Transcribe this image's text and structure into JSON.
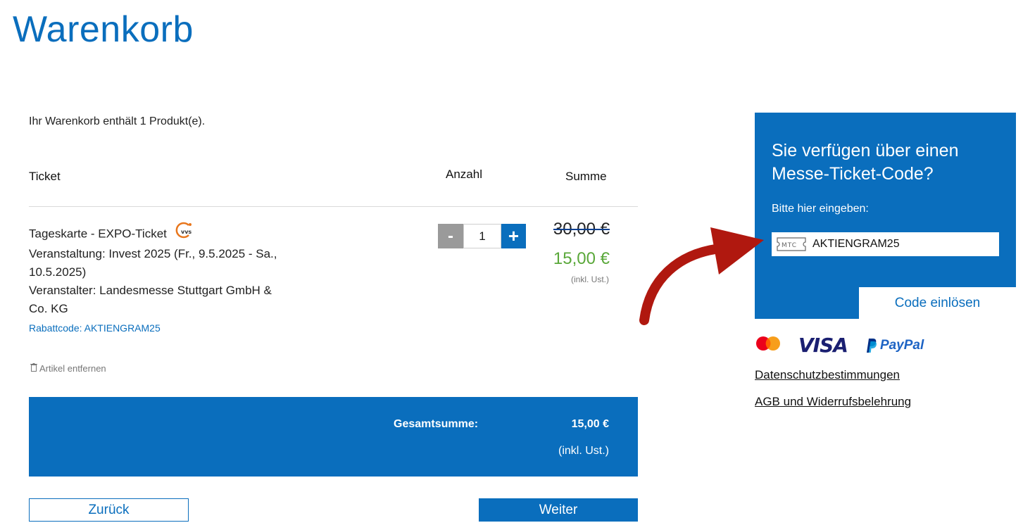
{
  "page": {
    "title": "Warenkorb",
    "cart_count_text": "Ihr Warenkorb enthält 1 Produkt(e)."
  },
  "table": {
    "col_ticket": "Ticket",
    "col_qty": "Anzahl",
    "col_sum": "Summe"
  },
  "item": {
    "name": "Tageskarte - EXPO-Ticket",
    "badge_text": "vvs",
    "event_line": "Veranstaltung: Invest 2025 (Fr., 9.5.2025 - Sa., 10.5.2025)",
    "organizer_line": "Veranstalter: Landesmesse Stuttgart GmbH & Co. KG",
    "discount_line": "Rabattcode: AKTIENGRAM25",
    "quantity": "1",
    "minus_label": "-",
    "plus_label": "+",
    "price_old": "30,00 €",
    "price_new": "15,00 €",
    "price_tax": "(inkl. Ust.)",
    "remove_label": "Artikel entfernen"
  },
  "total": {
    "label": "Gesamtsumme:",
    "value": "15,00 €",
    "tax": "(inkl. Ust.)"
  },
  "buttons": {
    "back": "Zurück",
    "next": "Weiter"
  },
  "code_panel": {
    "title": "Sie verfügen über einen Messe-Ticket-Code?",
    "subtitle": "Bitte hier eingeben:",
    "input_prefix": "MTC",
    "input_value": "AKTIENGRAM25",
    "redeem_label": "Code einlösen"
  },
  "payments": {
    "visa": "VISA",
    "paypal": "PayPal"
  },
  "links": {
    "privacy": "Datenschutzbestimmungen",
    "agb": "AGB und Widerrufsbelehrung"
  },
  "colors": {
    "brand_blue": "#0a6ebd",
    "price_green": "#5aa83a",
    "arrow_red": "#b0180f"
  }
}
